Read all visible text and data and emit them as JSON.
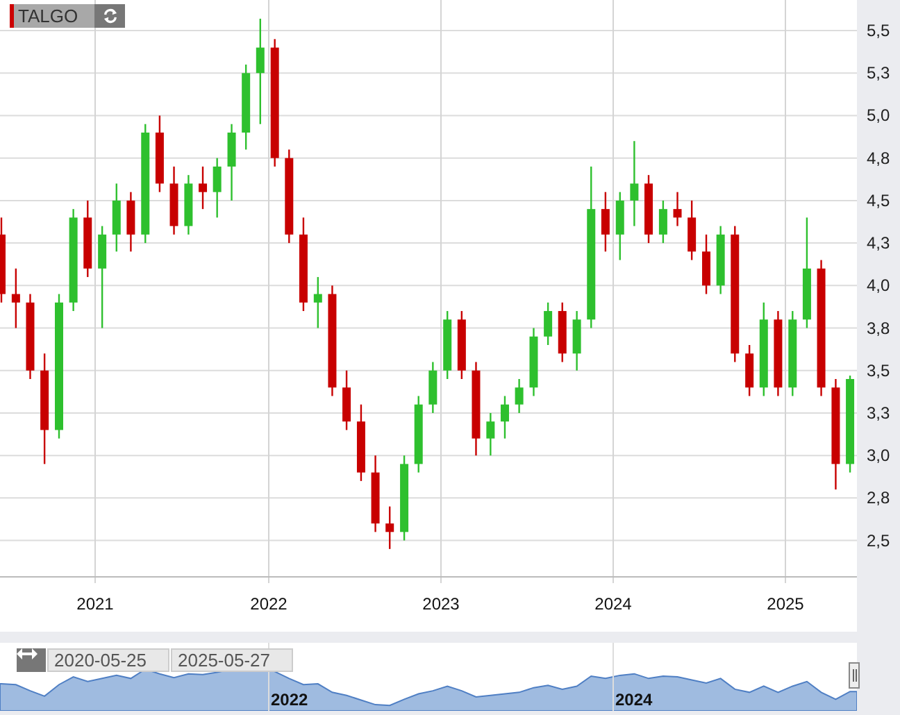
{
  "symbol": {
    "label": "TALGO"
  },
  "chart_data": {
    "type": "candlestick",
    "x": [
      2020.458,
      2020.542,
      2020.625,
      2020.708,
      2020.792,
      2020.875,
      2020.958,
      2021.042,
      2021.125,
      2021.208,
      2021.292,
      2021.375,
      2021.458,
      2021.542,
      2021.625,
      2021.708,
      2021.792,
      2021.875,
      2021.958,
      2022.042,
      2022.125,
      2022.208,
      2022.292,
      2022.375,
      2022.458,
      2022.542,
      2022.625,
      2022.708,
      2022.792,
      2022.875,
      2022.958,
      2023.042,
      2023.125,
      2023.208,
      2023.292,
      2023.375,
      2023.458,
      2023.542,
      2023.625,
      2023.708,
      2023.792,
      2023.875,
      2023.958,
      2024.042,
      2024.125,
      2024.208,
      2024.292,
      2024.375,
      2024.458,
      2024.542,
      2024.625,
      2024.708,
      2024.792,
      2024.875,
      2024.958,
      2025.042,
      2025.125,
      2025.208,
      2025.292,
      2025.375
    ],
    "ohlc": [
      [
        4.3,
        4.4,
        3.9,
        3.95
      ],
      [
        3.95,
        4.1,
        3.75,
        3.9
      ],
      [
        3.9,
        3.95,
        3.45,
        3.5
      ],
      [
        3.5,
        3.6,
        2.95,
        3.15
      ],
      [
        3.15,
        3.95,
        3.1,
        3.9
      ],
      [
        3.9,
        4.45,
        3.85,
        4.4
      ],
      [
        4.4,
        4.5,
        4.05,
        4.1
      ],
      [
        4.1,
        4.35,
        3.75,
        4.3
      ],
      [
        4.3,
        4.6,
        4.2,
        4.5
      ],
      [
        4.5,
        4.55,
        4.2,
        4.3
      ],
      [
        4.3,
        4.95,
        4.25,
        4.9
      ],
      [
        4.9,
        5.0,
        4.55,
        4.6
      ],
      [
        4.6,
        4.7,
        4.3,
        4.35
      ],
      [
        4.35,
        4.65,
        4.3,
        4.6
      ],
      [
        4.6,
        4.7,
        4.45,
        4.55
      ],
      [
        4.55,
        4.75,
        4.4,
        4.7
      ],
      [
        4.7,
        4.95,
        4.5,
        4.9
      ],
      [
        4.9,
        5.3,
        4.8,
        5.25
      ],
      [
        5.25,
        5.57,
        4.95,
        5.4
      ],
      [
        5.4,
        5.45,
        4.7,
        4.75
      ],
      [
        4.75,
        4.8,
        4.25,
        4.3
      ],
      [
        4.3,
        4.4,
        3.85,
        3.9
      ],
      [
        3.9,
        4.05,
        3.75,
        3.95
      ],
      [
        3.95,
        4.0,
        3.35,
        3.4
      ],
      [
        3.4,
        3.5,
        3.15,
        3.2
      ],
      [
        3.2,
        3.3,
        2.85,
        2.9
      ],
      [
        2.9,
        3.0,
        2.55,
        2.6
      ],
      [
        2.6,
        2.7,
        2.45,
        2.55
      ],
      [
        2.55,
        3.0,
        2.5,
        2.95
      ],
      [
        2.95,
        3.35,
        2.9,
        3.3
      ],
      [
        3.3,
        3.55,
        3.25,
        3.5
      ],
      [
        3.5,
        3.85,
        3.45,
        3.8
      ],
      [
        3.8,
        3.85,
        3.45,
        3.5
      ],
      [
        3.5,
        3.55,
        3.0,
        3.1
      ],
      [
        3.1,
        3.25,
        3.0,
        3.2
      ],
      [
        3.2,
        3.35,
        3.1,
        3.3
      ],
      [
        3.3,
        3.45,
        3.25,
        3.4
      ],
      [
        3.4,
        3.75,
        3.35,
        3.7
      ],
      [
        3.7,
        3.9,
        3.65,
        3.85
      ],
      [
        3.85,
        3.9,
        3.55,
        3.6
      ],
      [
        3.6,
        3.85,
        3.5,
        3.8
      ],
      [
        3.8,
        4.7,
        3.75,
        4.45
      ],
      [
        4.45,
        4.55,
        4.2,
        4.3
      ],
      [
        4.3,
        4.55,
        4.15,
        4.5
      ],
      [
        4.5,
        4.85,
        4.35,
        4.6
      ],
      [
        4.6,
        4.65,
        4.25,
        4.3
      ],
      [
        4.3,
        4.5,
        4.25,
        4.45
      ],
      [
        4.45,
        4.55,
        4.35,
        4.4
      ],
      [
        4.4,
        4.5,
        4.15,
        4.2
      ],
      [
        4.2,
        4.3,
        3.95,
        4.0
      ],
      [
        4.0,
        4.35,
        3.95,
        4.3
      ],
      [
        4.3,
        4.35,
        3.55,
        3.6
      ],
      [
        3.6,
        3.65,
        3.35,
        3.4
      ],
      [
        3.4,
        3.9,
        3.35,
        3.8
      ],
      [
        3.8,
        3.85,
        3.35,
        3.4
      ],
      [
        3.4,
        3.85,
        3.35,
        3.8
      ],
      [
        3.8,
        4.4,
        3.75,
        4.1
      ],
      [
        4.1,
        4.15,
        3.35,
        3.4
      ],
      [
        3.4,
        3.45,
        2.8,
        2.95
      ],
      [
        2.95,
        3.47,
        2.9,
        3.45
      ]
    ],
    "xlim": [
      2020.45,
      2025.415
    ],
    "ylim": [
      2.29,
      5.68
    ],
    "grid": true,
    "yticks": [
      {
        "value": 5.5,
        "label": "5,5"
      },
      {
        "value": 5.25,
        "label": "5,3"
      },
      {
        "value": 5.0,
        "label": "5,0"
      },
      {
        "value": 4.75,
        "label": "4,8"
      },
      {
        "value": 4.5,
        "label": "4,5"
      },
      {
        "value": 4.25,
        "label": "4,3"
      },
      {
        "value": 4.0,
        "label": "4,0"
      },
      {
        "value": 3.75,
        "label": "3,8"
      },
      {
        "value": 3.5,
        "label": "3,5"
      },
      {
        "value": 3.25,
        "label": "3,3"
      },
      {
        "value": 3.0,
        "label": "3,0"
      },
      {
        "value": 2.75,
        "label": "2,8"
      },
      {
        "value": 2.5,
        "label": "2,5"
      }
    ],
    "xticks": [
      2021,
      2022,
      2023,
      2024,
      2025
    ]
  },
  "navigator": {
    "start": "2020-05-25",
    "end": "2025-05-27",
    "ticks": [
      "2022",
      "2024"
    ]
  }
}
